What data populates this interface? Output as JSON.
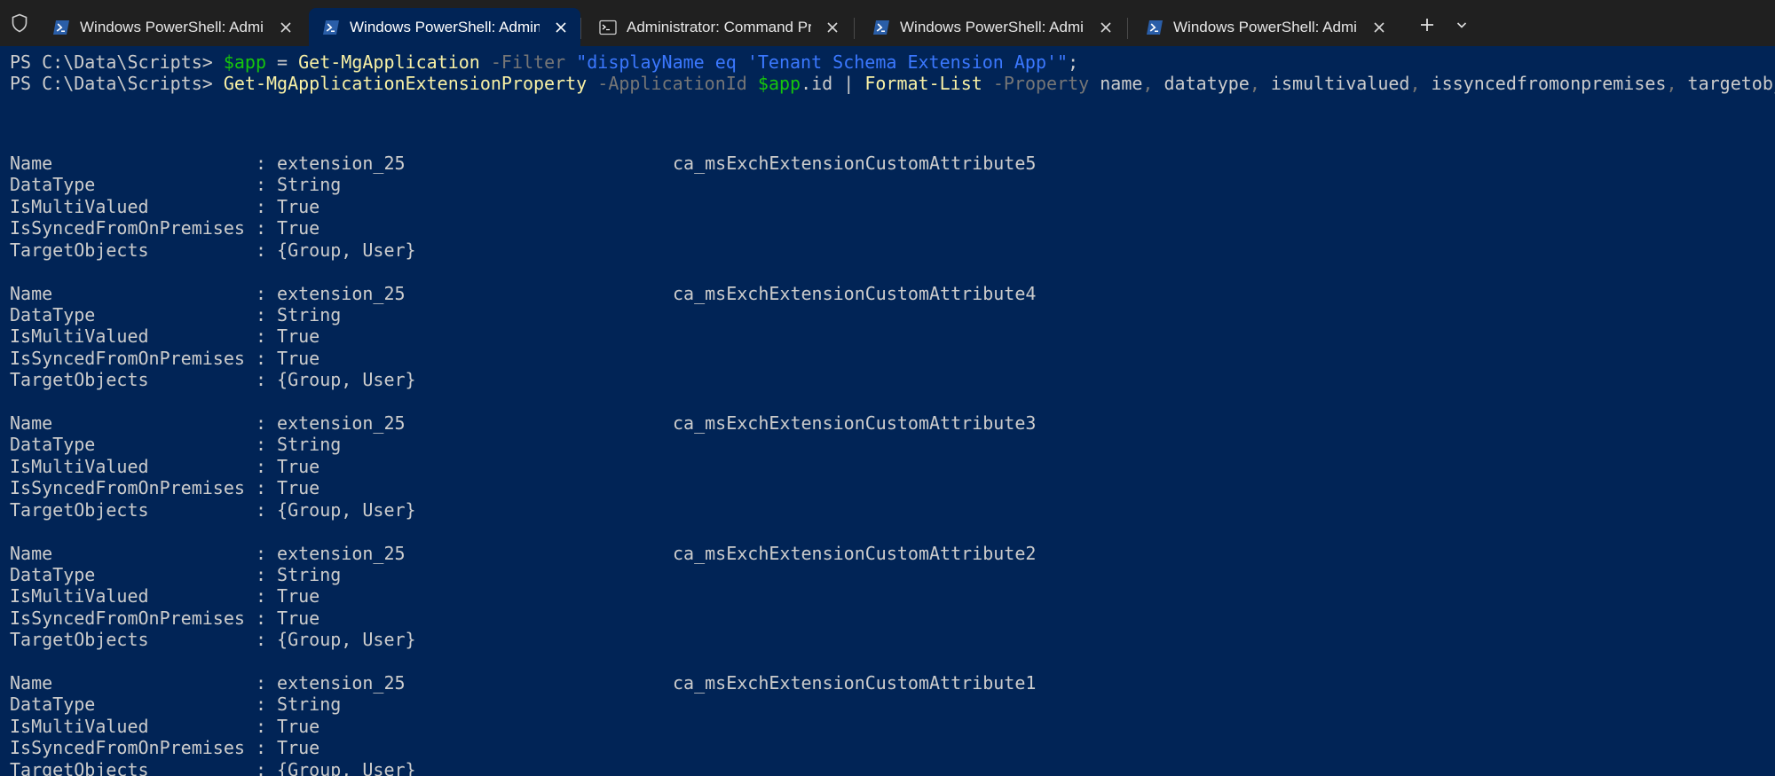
{
  "tabbar": {
    "tabs": [
      {
        "label": "Windows PowerShell: Administ",
        "icon": "powershell-icon",
        "active": false
      },
      {
        "label": "Windows PowerShell: Adminis",
        "icon": "powershell-icon",
        "active": true
      },
      {
        "label": "Administrator: Command Prom",
        "icon": "cmd-icon",
        "active": false
      },
      {
        "label": "Windows PowerShell: Administ",
        "icon": "powershell-icon",
        "active": false
      },
      {
        "label": "Windows PowerShell: Administ",
        "icon": "powershell-icon",
        "active": false
      }
    ],
    "new_tab_icon": "plus-icon",
    "dropdown_icon": "chevron-down-icon",
    "shield_icon": "shield-icon"
  },
  "colors": {
    "background": "#012456",
    "tabbar": "#202020",
    "variable": "#16c60c",
    "command": "#f9f1a5",
    "parameter": "#767676",
    "string": "#3b78ff",
    "text": "#cccccc"
  },
  "terminal": {
    "commands": [
      {
        "prompt": "PS C:\\Data\\Scripts> ",
        "tokens": [
          {
            "t": "$app",
            "c": "var"
          },
          {
            "t": " = ",
            "c": "plain"
          },
          {
            "t": "Get-MgApplication",
            "c": "cmd"
          },
          {
            "t": " -Filter",
            "c": "param"
          },
          {
            "t": " \"displayName eq 'Tenant Schema Extension App'\"",
            "c": "str"
          },
          {
            "t": ";",
            "c": "plain"
          }
        ]
      },
      {
        "prompt": "PS C:\\Data\\Scripts> ",
        "tokens": [
          {
            "t": "Get-MgApplicationExtensionProperty",
            "c": "cmd"
          },
          {
            "t": " -ApplicationId",
            "c": "param"
          },
          {
            "t": " $app",
            "c": "var"
          },
          {
            "t": ".id",
            "c": "plain"
          },
          {
            "t": " | ",
            "c": "plain"
          },
          {
            "t": "Format-List",
            "c": "cmd"
          },
          {
            "t": " -Property",
            "c": "param"
          },
          {
            "t": " name",
            "c": "plain"
          },
          {
            "t": ",",
            "c": "param"
          },
          {
            "t": " datatype",
            "c": "plain"
          },
          {
            "t": ",",
            "c": "param"
          },
          {
            "t": " ismultivalued",
            "c": "plain"
          },
          {
            "t": ",",
            "c": "param"
          },
          {
            "t": " issyncedfromonpremises",
            "c": "plain"
          },
          {
            "t": ",",
            "c": "param"
          },
          {
            "t": " targetobjects",
            "c": "plain"
          },
          {
            "t": ";",
            "c": "plain"
          }
        ]
      }
    ],
    "records": [
      {
        "Name": "extension_25",
        "NameSuffix": "ca_msExchExtensionCustomAttribute5",
        "DataType": "String",
        "IsMultiValued": "True",
        "IsSyncedFromOnPremises": "True",
        "TargetObjects": "{Group, User}"
      },
      {
        "Name": "extension_25",
        "NameSuffix": "ca_msExchExtensionCustomAttribute4",
        "DataType": "String",
        "IsMultiValued": "True",
        "IsSyncedFromOnPremises": "True",
        "TargetObjects": "{Group, User}"
      },
      {
        "Name": "extension_25",
        "NameSuffix": "ca_msExchExtensionCustomAttribute3",
        "DataType": "String",
        "IsMultiValued": "True",
        "IsSyncedFromOnPremises": "True",
        "TargetObjects": "{Group, User}"
      },
      {
        "Name": "extension_25",
        "NameSuffix": "ca_msExchExtensionCustomAttribute2",
        "DataType": "String",
        "IsMultiValued": "True",
        "IsSyncedFromOnPremises": "True",
        "TargetObjects": "{Group, User}"
      },
      {
        "Name": "extension_25",
        "NameSuffix": "ca_msExchExtensionCustomAttribute1",
        "DataType": "String",
        "IsMultiValued": "True",
        "IsSyncedFromOnPremises": "True",
        "TargetObjects": "{Group, User}"
      }
    ],
    "field_labels": {
      "Name": "Name                   : ",
      "DataType": "DataType               : ",
      "IsMultiValued": "IsMultiValued          : ",
      "IsSyncedFromOnPremises": "IsSyncedFromOnPremises : ",
      "TargetObjects": "TargetObjects          : "
    }
  }
}
